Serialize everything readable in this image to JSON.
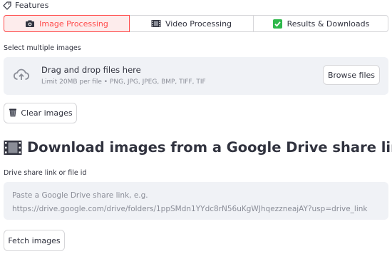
{
  "features": {
    "label": "Features",
    "icon": "tag-icon"
  },
  "tabs": [
    {
      "label": "Image Processing",
      "icon": "camera-icon",
      "active": true
    },
    {
      "label": "Video Processing",
      "icon": "film-icon",
      "active": false
    },
    {
      "label": "Results & Downloads",
      "icon": "checkmark-icon",
      "active": false
    }
  ],
  "uploader": {
    "label": "Select multiple images",
    "title": "Drag and drop files here",
    "limit": "Limit 20MB per file • PNG, JPG, JPEG, BMP, TIFF, TIF",
    "browse_label": "Browse files",
    "icon": "upload-cloud-icon"
  },
  "clear": {
    "label": "Clear images",
    "icon": "wastebasket-icon"
  },
  "drive": {
    "heading": "Download images from a Google Drive share link",
    "heading_icon": "film-icon",
    "input_label": "Drive share link or file id",
    "placeholder": "Paste a Google Drive share link, e.g.\nhttps://drive.google.com/drive/folders/1ppSMdn1YYdc8rN56uKgWJhqezzneajAY?usp=drive_link",
    "fetch_label": "Fetch images"
  },
  "colors": {
    "accent": "#ff4b4b",
    "accent_bg": "#fdecec",
    "input_bg": "#f0f2f6",
    "text": "#31333f",
    "muted": "#8a8d97",
    "border": "#d6d6d9",
    "check_green": "#2eb84b"
  }
}
